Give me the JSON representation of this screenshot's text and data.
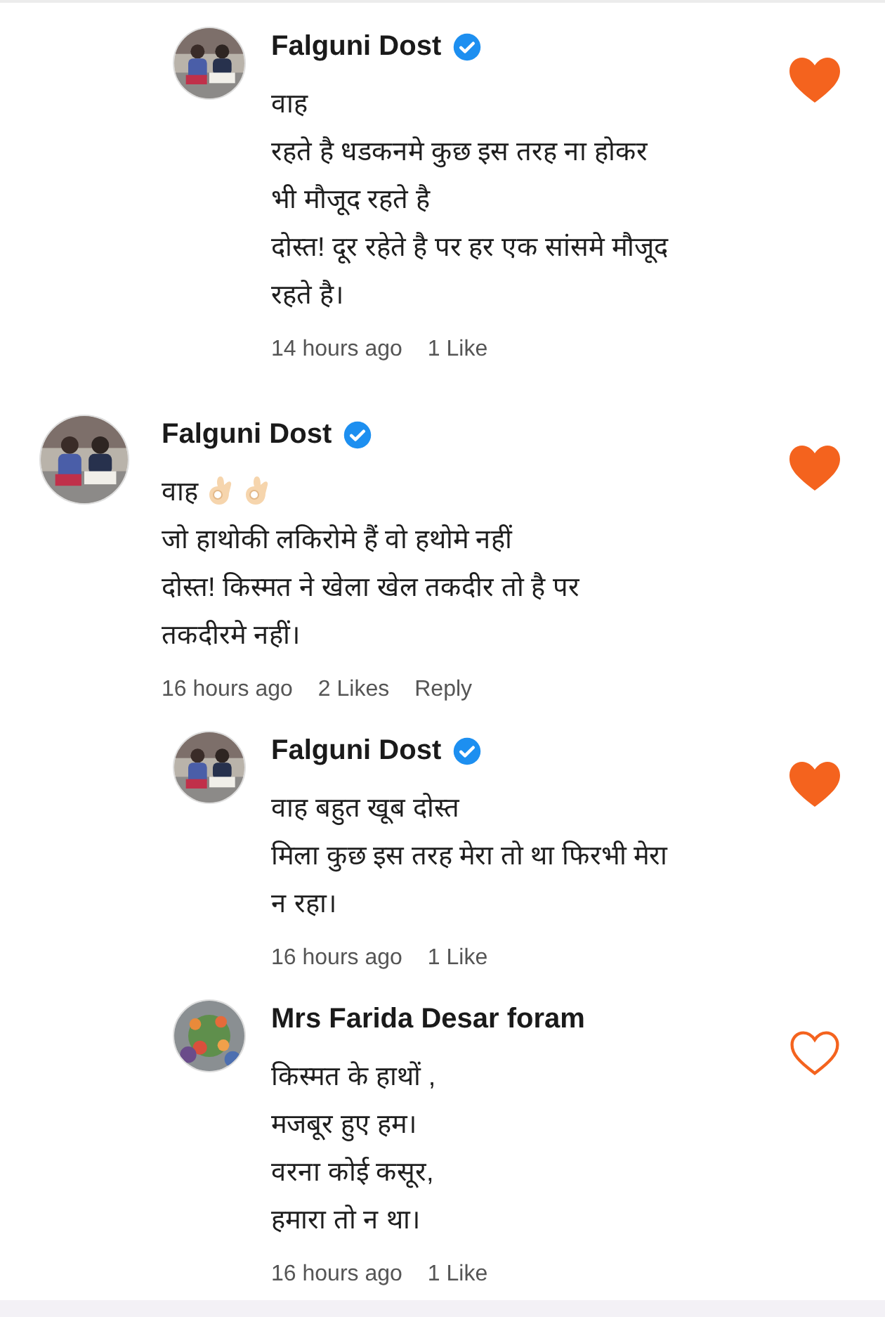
{
  "replies_above": [
    {
      "author": "Falguni Dost",
      "verified": true,
      "liked": true,
      "lines": [
        {
          "text": "वाह"
        },
        {
          "text": "रहते है धडकनमे कुछ इस तरह ना होकर"
        },
        {
          "text": "भी मौजूद रहते है"
        },
        {
          "text": "दोस्त! दूर रहेते है पर हर एक सांसमे मौजूद"
        },
        {
          "text": "रहते है।"
        }
      ],
      "time": "14 hours ago",
      "likes": "1 Like"
    }
  ],
  "comments": [
    {
      "author": "Falguni Dost",
      "verified": true,
      "liked": true,
      "lines": [
        {
          "text": "वाह",
          "trailing_icons": [
            {
              "kind": "ok-hand"
            },
            {
              "kind": "ok-hand"
            }
          ]
        },
        {
          "text": "जो हाथोकी लकिरोमे हैं वो हथोमे नहीं"
        },
        {
          "text": "दोस्त! किस्मत ने खेला खेल तकदीर तो है पर"
        },
        {
          "text": "तकदीरमे नहीं।"
        }
      ],
      "time": "16 hours ago",
      "likes": "2 Likes",
      "reply": "Reply",
      "children": [
        {
          "author": "Falguni Dost",
          "verified": true,
          "liked": true,
          "lines": [
            {
              "text": "वाह बहुत खूब दोस्त"
            },
            {
              "text": "मिला कुछ इस तरह मेरा तो था फिरभी मेरा"
            },
            {
              "text": "न रहा।"
            }
          ],
          "time": "16 hours ago",
          "likes": "1 Like"
        },
        {
          "author": "Mrs Farida Desar foram",
          "verified": false,
          "liked": false,
          "lines": [
            {
              "text": "किस्मत के हाथों ,"
            },
            {
              "text": "मजबूर हुए हम।"
            },
            {
              "text": "वरना कोई कसूर,"
            },
            {
              "text": "हमारा तो न था।"
            }
          ],
          "time": "16 hours ago",
          "likes": "1 Like"
        }
      ]
    }
  ]
}
